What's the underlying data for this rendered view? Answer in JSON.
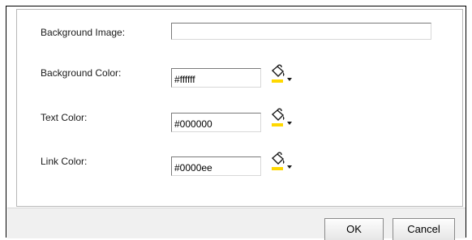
{
  "form": {
    "background_image": {
      "label": "Background Image:",
      "value": ""
    },
    "background_color": {
      "label": "Background Color:",
      "value": "#ffffff"
    },
    "text_color": {
      "label": "Text Color:",
      "value": "#000000"
    },
    "link_color": {
      "label": "Link Color:",
      "value": "#0000ee"
    }
  },
  "picker_icon": "paint-bucket-icon",
  "buttons": {
    "ok": "OK",
    "cancel": "Cancel"
  },
  "colors": {
    "picker_fill": "#ffd800",
    "bucket_stroke": "#1a1a1a",
    "button_bar": "#f0f0f0"
  }
}
